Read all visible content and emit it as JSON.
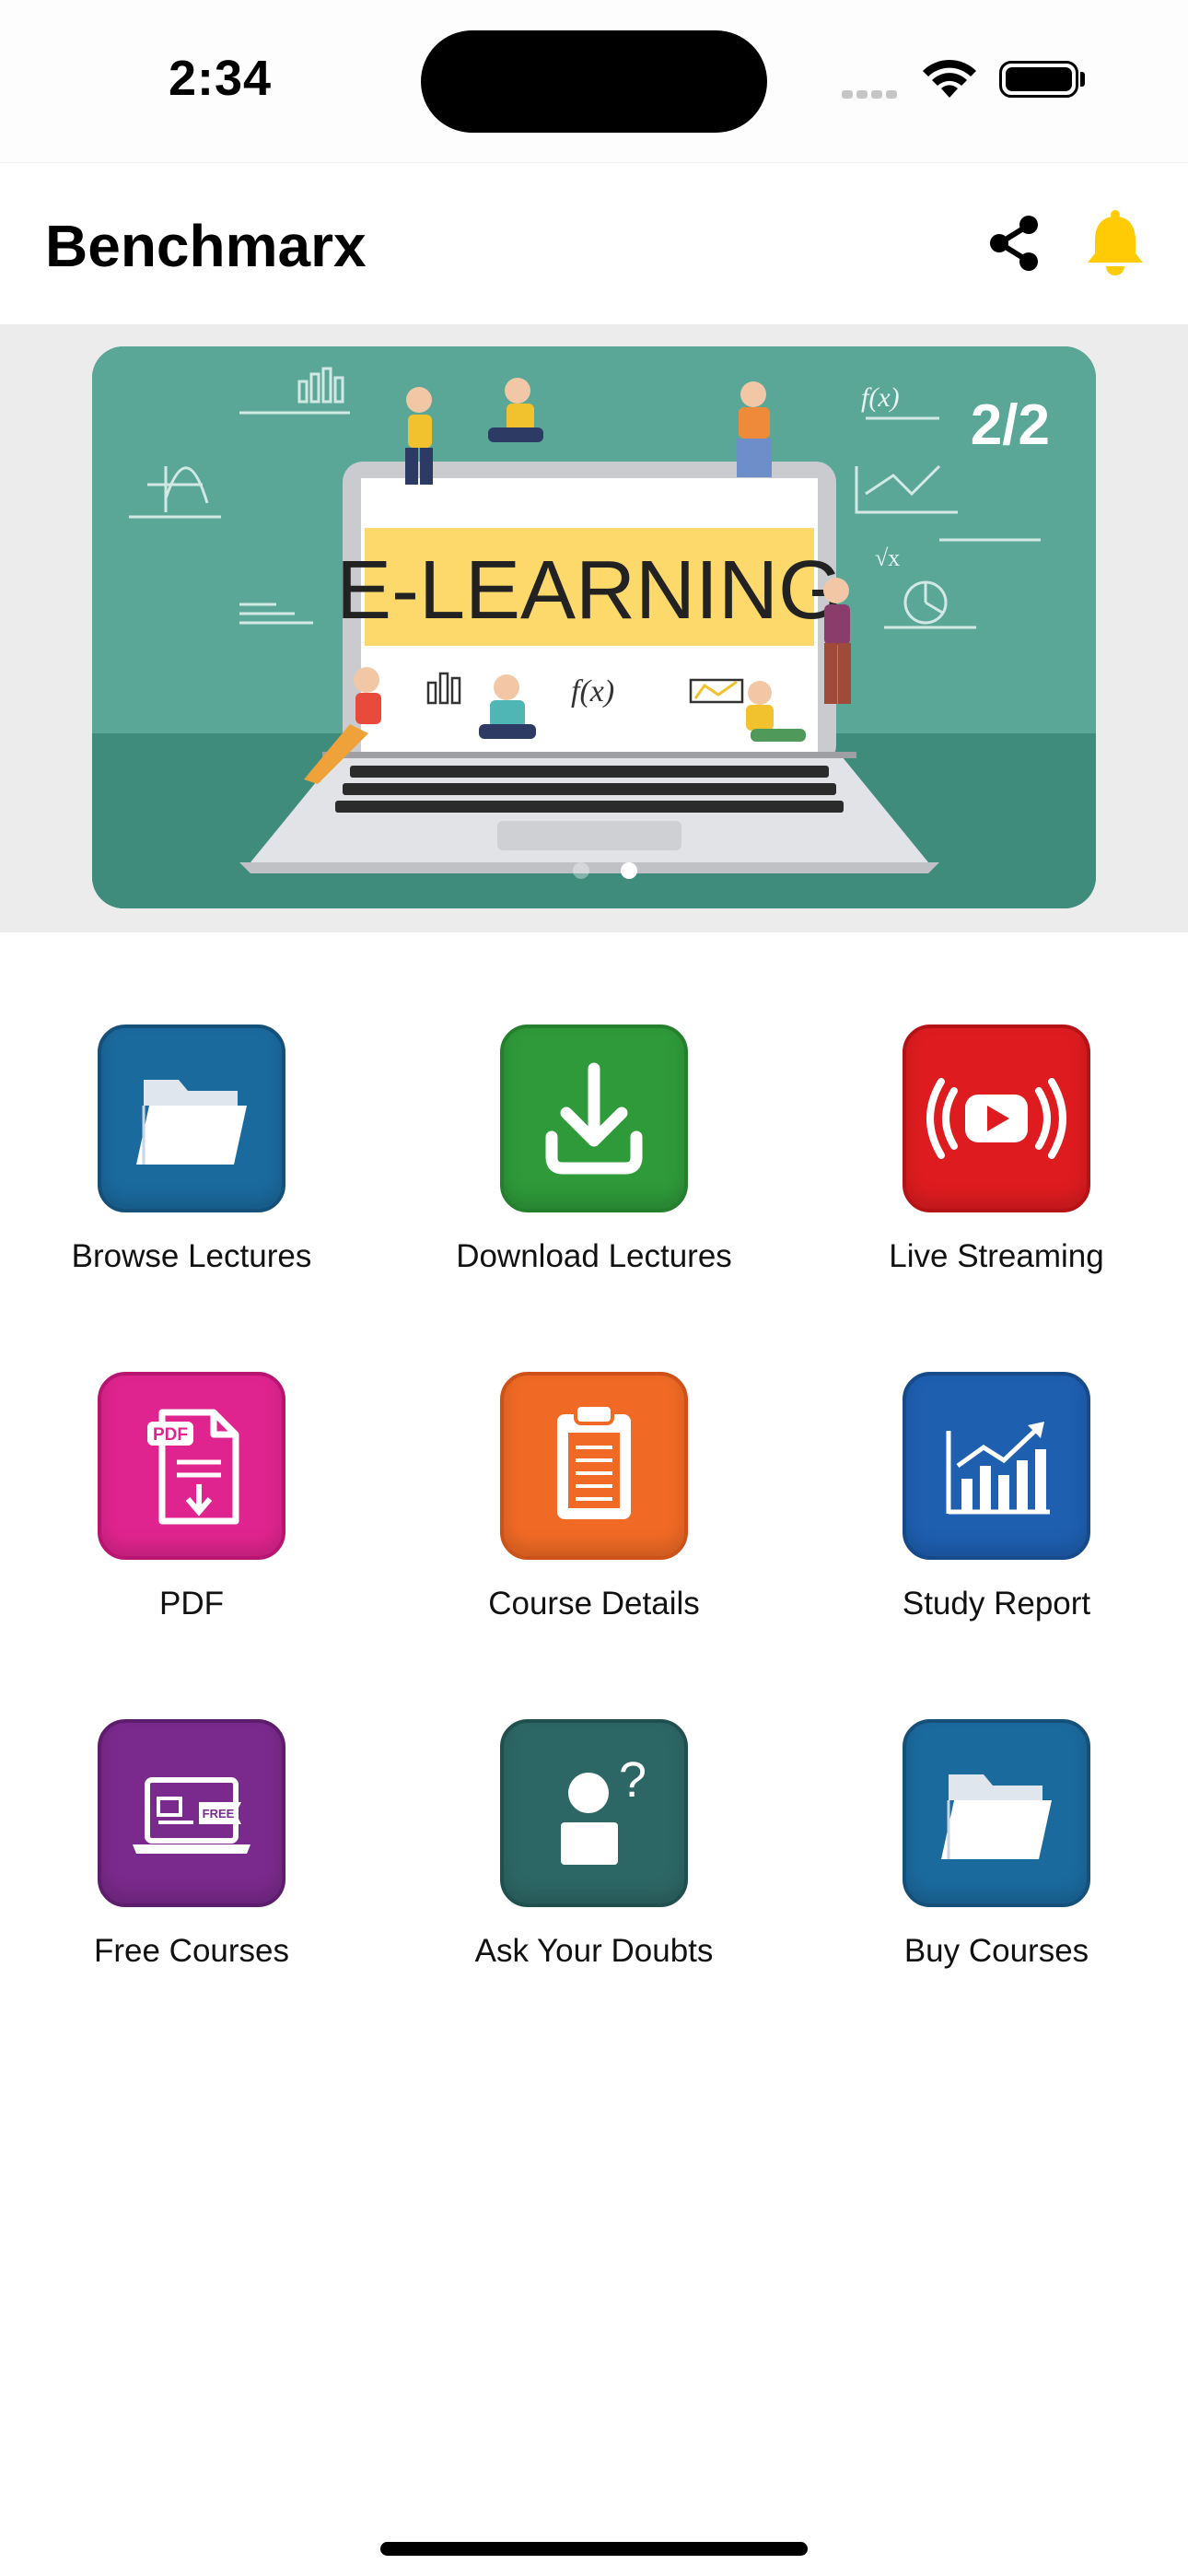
{
  "status_bar": {
    "time": "2:34"
  },
  "header": {
    "title": "Benchmarx",
    "bell_color": "#FFCB05"
  },
  "banner": {
    "counter": "2/2",
    "headline": "E-LEARNING",
    "slide_count": 2,
    "active_slide": 2
  },
  "menu": [
    {
      "label": "Browse Lectures",
      "icon": "folder-icon",
      "color": "#1B6A9E"
    },
    {
      "label": "Download Lectures",
      "icon": "download-icon",
      "color": "#2F9A3A"
    },
    {
      "label": "Live Streaming",
      "icon": "live-stream-icon",
      "color": "#DE1C20"
    },
    {
      "label": "PDF",
      "icon": "pdf-icon",
      "color": "#E0248F"
    },
    {
      "label": "Course Details",
      "icon": "clipboard-icon",
      "color": "#F06A25"
    },
    {
      "label": "Study Report",
      "icon": "chart-icon",
      "color": "#1E5FB0"
    },
    {
      "label": "Free Courses",
      "icon": "laptop-free-icon",
      "color": "#7A2A8C"
    },
    {
      "label": "Ask Your Doubts",
      "icon": "question-person-icon",
      "color": "#2D6765"
    },
    {
      "label": "Buy Courses",
      "icon": "folder-icon",
      "color": "#1B6A9E"
    }
  ]
}
